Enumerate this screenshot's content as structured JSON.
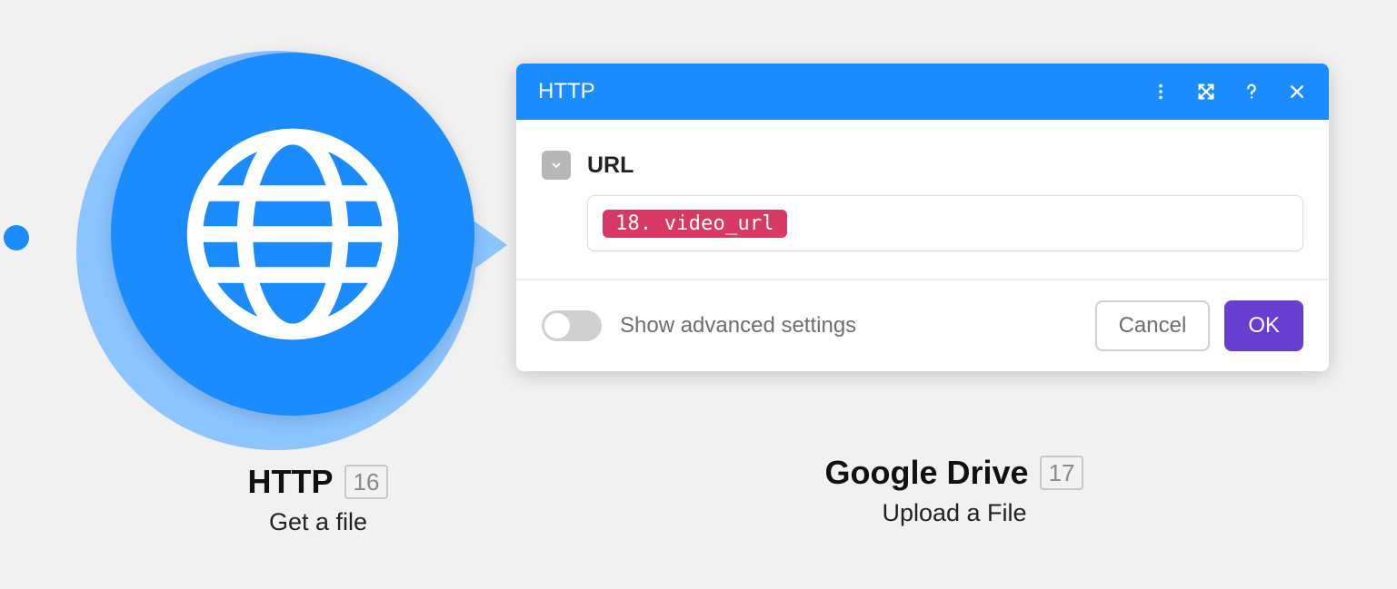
{
  "left_module": {
    "name": "HTTP",
    "subtitle": "Get a file",
    "id": "16"
  },
  "right_module": {
    "name": "Google Drive",
    "subtitle": "Upload a File",
    "id": "17"
  },
  "dialog": {
    "title": "HTTP",
    "url_label": "URL",
    "url_value_pill": "18. video_url",
    "advanced_label": "Show advanced settings",
    "cancel_label": "Cancel",
    "ok_label": "OK"
  }
}
